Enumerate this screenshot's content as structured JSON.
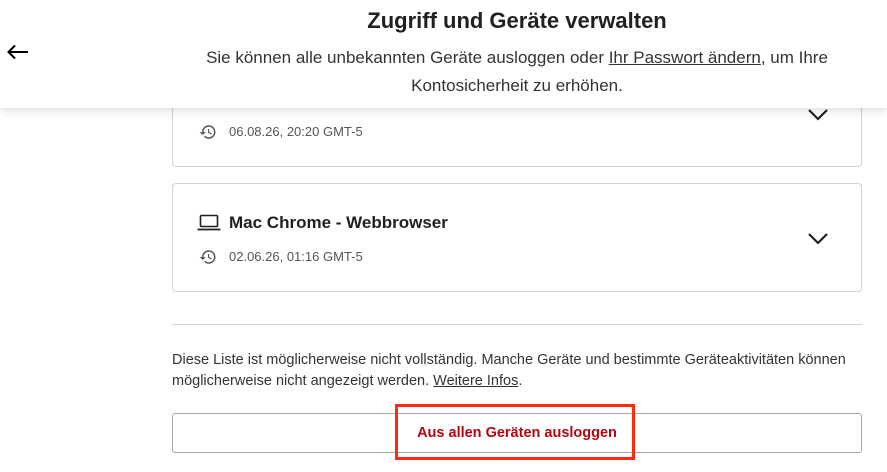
{
  "header": {
    "title": "Zugriff und Geräte verwalten",
    "subtitle_before": "Sie können alle unbekannten Geräte ausloggen oder ",
    "subtitle_link": "Ihr Passwort ändern",
    "subtitle_after": ", um Ihre Kontosicherheit zu erhöhen."
  },
  "devices": [
    {
      "name": "",
      "timestamp": "06.08.26, 20:20 GMT-5",
      "icon": "device-icon"
    },
    {
      "name": "Mac Chrome - Webbrowser",
      "timestamp": "02.06.26, 01:16 GMT-5",
      "icon": "laptop-icon"
    }
  ],
  "footer": {
    "note": "Diese Liste ist möglicherweise nicht vollständig. Manche Geräte und bestimmte Geräteaktivitäten können möglicherweise nicht angezeigt werden. ",
    "note_link": "Weitere Infos",
    "note_end": "."
  },
  "signout_button": {
    "label": "Aus allen Geräten ausloggen"
  },
  "colors": {
    "signout_text": "#b20710",
    "highlight": "#ff2a14",
    "border": "#d2d2d2"
  }
}
